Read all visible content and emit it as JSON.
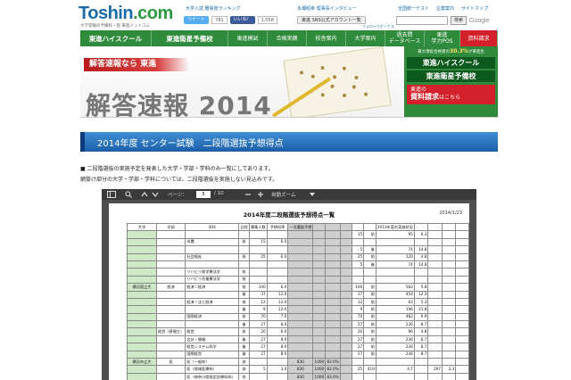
{
  "header": {
    "logo_main": "Toshin",
    "logo_suffix": ".com",
    "tagline": "大学受験の予備校・塾 東進ドットコム",
    "ranking_link": "大学入試 難易度ランキング",
    "tweet_label": "ツイート",
    "tweet_count": "781",
    "like_label": "いいね！",
    "like_count": "1,058",
    "interview_link": "永瀬昭幸 理事長インタビュー",
    "sns_button": "東進 SNS公式アカウント一覧",
    "follow_text": "フォローでボーナス",
    "top_links": [
      "全国統一テスト",
      "企業案内",
      "サイトマップ"
    ],
    "search_button": "検索",
    "google_label": "Google"
  },
  "nav": {
    "items": [
      {
        "label": "東進ハイスクール",
        "brand": true,
        "w": 80
      },
      {
        "label": "東進衛星予備校",
        "brand": true,
        "w": 86
      },
      {
        "label": "東進模試",
        "brand": false,
        "w": 44
      },
      {
        "label": "合格実績",
        "brand": false,
        "w": 44
      },
      {
        "label": "校舎案内",
        "brand": false,
        "w": 44
      },
      {
        "label": "大学案内",
        "brand": false,
        "w": 44
      },
      {
        "label": "過去問\nデータベース",
        "brand": false,
        "w": 44
      },
      {
        "label": "東進\n学力POS",
        "brand": false,
        "w": 40
      },
      {
        "label": "資料請求",
        "brand": false,
        "w": 42
      }
    ]
  },
  "banner": {
    "tag": "解答速報なら 東進",
    "title": "解答速報 2014",
    "ad_copy_1": "東大現役合格者の",
    "ad_copy_pct": "30.3%",
    "ad_copy_2": "が東進生",
    "ad_brand_1": "東進ハイスクール",
    "ad_brand_2": "東進衛星予備校",
    "ad_req_1": "東進の",
    "ad_req_2": "資料請求",
    "ad_req_3": "はこちら"
  },
  "page": {
    "heading": "2014年度 センター試験　二段階選抜予想得点",
    "desc_1": "■ 二段階選抜の実施予定を発表した大学・学部・学科のみ一覧にしてあります。",
    "desc_2": "網掛け部分の大学・学部・学科については、二段階選抜を実施しない見込みです。"
  },
  "viewer": {
    "page_label": "ページ：",
    "current_page": "5",
    "total_pages": "/ 10",
    "zoom_label": "自動ズーム",
    "doc_title": "2014年度二段階選抜予想得点一覧",
    "doc_date": "2014/1/23",
    "headers": [
      "大学",
      "学部",
      "学科",
      "日程",
      "募集人数",
      "予想倍率",
      "一次選抜予想",
      "",
      "",
      "",
      "",
      "",
      "2013年度の実施状況",
      "",
      "",
      "",
      ""
    ],
    "rows": [
      [
        "",
        "",
        "",
        "",
        "",
        "",
        "",
        "",
        "",
        "",
        "15",
        "前",
        "95",
        "6.3",
        "",
        "",
        ""
      ],
      [
        "",
        "",
        "米農",
        "前",
        "15",
        "6.0",
        "",
        "",
        "",
        "",
        "",
        "",
        "",
        "",
        "",
        "",
        ""
      ],
      [
        "",
        "",
        "",
        "",
        "",
        "",
        "",
        "",
        "",
        "",
        "5",
        "後",
        "74",
        "14.8",
        "",
        "",
        ""
      ],
      [
        "",
        "",
        "社会福祉",
        "前",
        "25",
        "6.0",
        "",
        "",
        "",
        "",
        "25",
        "前",
        "120",
        "4.8",
        "",
        "",
        ""
      ],
      [
        "",
        "",
        "",
        "",
        "",
        "",
        "",
        "",
        "",
        "",
        "5",
        "後",
        "74",
        "14.8",
        "",
        "",
        ""
      ],
      [
        "",
        "",
        "リハビリ理学療法学",
        "前",
        "",
        "",
        "",
        "",
        "",
        "",
        "",
        "",
        "",
        "",
        "",
        "",
        ""
      ],
      [
        "",
        "",
        "リハビリ作業療法学",
        "前",
        "",
        "",
        "",
        "",
        "",
        "",
        "",
        "",
        "",
        "",
        "",
        "",
        ""
      ],
      [
        "横浜国立大",
        "経済",
        "経済＝経済",
        "前",
        "100",
        "6.0",
        "",
        "",
        "",
        "",
        "100",
        "前",
        "582",
        "5.8",
        "",
        "",
        ""
      ],
      [
        "",
        "",
        "",
        "後",
        "37",
        "12.0",
        "",
        "",
        "",
        "",
        "37",
        "前",
        "454",
        "12.3",
        "",
        "",
        ""
      ],
      [
        "",
        "",
        "経済＝法と経済",
        "前",
        "12",
        "12.0",
        "",
        "",
        "",
        "",
        "12",
        "前",
        "63",
        "5.3",
        "",
        "",
        ""
      ],
      [
        "",
        "",
        "",
        "後",
        "9",
        "12.0",
        "",
        "",
        "",
        "",
        "9",
        "前",
        "196",
        "21.8",
        "",
        "",
        ""
      ],
      [
        "",
        "",
        "国際経済",
        "前",
        "70",
        "7.0",
        "",
        "",
        "",
        "",
        "70",
        "前",
        "482",
        "6.9",
        "",
        "",
        ""
      ],
      [
        "",
        "",
        "",
        "後",
        "27",
        "8.0",
        "",
        "",
        "",
        "",
        "27",
        "前",
        "236",
        "8.7",
        "",
        "",
        ""
      ],
      [
        "",
        "経営（昼間主）",
        "経営",
        "前",
        "20",
        "6.0",
        "",
        "",
        "",
        "",
        "20",
        "前",
        "96",
        "4.8",
        "",
        "",
        ""
      ],
      [
        "",
        "",
        "会計・情報",
        "後",
        "27",
        "8.0",
        "",
        "",
        "",
        "",
        "27",
        "前",
        "236",
        "8.7",
        "",
        "",
        ""
      ],
      [
        "",
        "",
        "経営システム科学",
        "後",
        "27",
        "8.0",
        "",
        "",
        "",
        "",
        "27",
        "前",
        "236",
        "8.7",
        "",
        "",
        ""
      ],
      [
        "",
        "",
        "国際経営",
        "後",
        "27",
        "8.0",
        "",
        "",
        "",
        "",
        "27",
        "前",
        "236",
        "8.7",
        "",
        "",
        ""
      ],
      [
        "横浜市立大",
        "医",
        "医（一般枠）",
        "前",
        "",
        "",
        "830",
        "1000",
        "83.0%",
        "",
        "",
        "",
        "",
        "",
        "",
        "",
        ""
      ],
      [
        "",
        "",
        "医（地域医療枠）",
        "前",
        "5",
        "3.0",
        "830",
        "1000",
        "83.0%",
        "",
        "25",
        "419",
        "4.7",
        "",
        "297",
        "3.3",
        ""
      ],
      [
        "",
        "",
        "医（神奈川県指定診療科枠）",
        "前",
        "",
        "",
        "830",
        "1000",
        "83.0%",
        "",
        "",
        "",
        "",
        "",
        "",
        "",
        ""
      ]
    ]
  }
}
